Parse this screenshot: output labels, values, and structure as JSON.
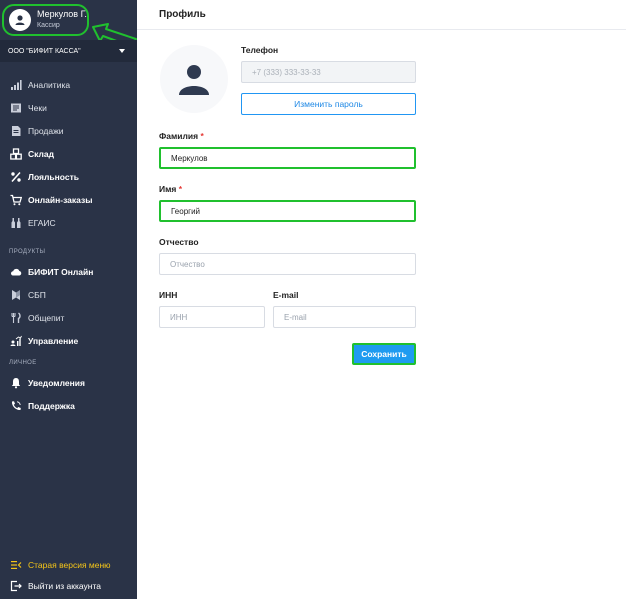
{
  "user": {
    "name": "Меркулов Г.",
    "role": "Кассир"
  },
  "company": {
    "name": "ООО \"БИФИТ КАССА\""
  },
  "sidebar": {
    "main_items": [
      {
        "label": "Аналитика",
        "icon": "bar-chart-icon"
      },
      {
        "label": "Чеки",
        "icon": "receipt-icon"
      },
      {
        "label": "Продажи",
        "icon": "document-icon"
      },
      {
        "label": "Склад",
        "icon": "boxes-icon"
      },
      {
        "label": "Лояльность",
        "icon": "percent-icon"
      },
      {
        "label": "Онлайн-заказы",
        "icon": "cart-icon"
      },
      {
        "label": "ЕГАИС",
        "icon": "bottles-icon"
      }
    ],
    "products_label": "ПРОДУКТЫ",
    "product_items": [
      {
        "label": "БИФИТ Онлайн",
        "icon": "cloud-icon"
      },
      {
        "label": "СБП",
        "icon": "sbp-icon"
      },
      {
        "label": "Общепит",
        "icon": "cutlery-icon"
      },
      {
        "label": "Управление",
        "icon": "people-chart-icon"
      }
    ],
    "personal_label": "ЛИЧНОЕ",
    "personal_items": [
      {
        "label": "Уведомления",
        "icon": "bell-icon"
      },
      {
        "label": "Поддержка",
        "icon": "phone-icon"
      }
    ],
    "old_menu": "Старая версия меню",
    "logout": "Выйти из аккаунта"
  },
  "profile": {
    "title": "Профиль",
    "phone_label": "Телефон",
    "phone_placeholder": "+7 (333) 333-33-33",
    "change_password": "Изменить пароль",
    "surname_label": "Фамилия",
    "surname_value": "Меркулов",
    "name_label": "Имя",
    "name_value": "Георгий",
    "patronymic_label": "Отчество",
    "patronymic_placeholder": "Отчество",
    "inn_label": "ИНН",
    "inn_placeholder": "ИНН",
    "email_label": "E-mail",
    "email_placeholder": "E-mail",
    "save": "Сохранить",
    "required_mark": "*"
  },
  "colors": {
    "sidebar": "#2a3347",
    "accent": "#1e9bf0",
    "highlight": "#20c02e",
    "old_menu": "#f5c518"
  }
}
